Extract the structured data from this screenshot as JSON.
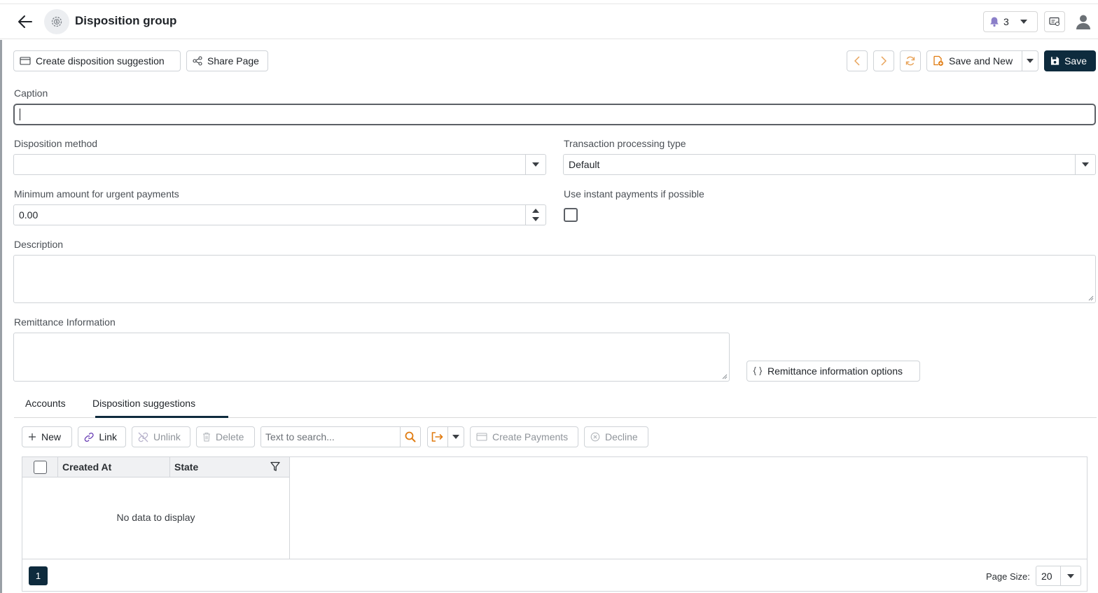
{
  "header": {
    "title": "Disposition group",
    "notification_count": "3",
    "icons": {
      "back": "arrow-left-icon",
      "module": "dollar-gear-icon",
      "notification": "bell-icon",
      "message": "message-icon",
      "user": "user-icon"
    }
  },
  "toolbar": {
    "create_suggestion_label": "Create disposition suggestion",
    "share_label": "Share Page",
    "save_and_new_label": "Save and New",
    "save_label": "Save"
  },
  "form": {
    "caption": {
      "label": "Caption",
      "value": ""
    },
    "disposition_method": {
      "label": "Disposition method",
      "value": ""
    },
    "transaction_processing_type": {
      "label": "Transaction processing type",
      "value": "Default"
    },
    "minimum_amount": {
      "label": "Minimum amount for urgent payments",
      "value": "0.00"
    },
    "use_instant_payments": {
      "label": "Use instant payments if possible",
      "checked": false
    },
    "description": {
      "label": "Description",
      "value": ""
    },
    "remittance_information": {
      "label": "Remittance Information",
      "value": ""
    },
    "remittance_options_label": "Remittance information options"
  },
  "tabs": [
    {
      "label": "Accounts",
      "active": false
    },
    {
      "label": "Disposition suggestions",
      "active": true
    }
  ],
  "grid_toolbar": {
    "new_label": "New",
    "link_label": "Link",
    "unlink_label": "Unlink",
    "delete_label": "Delete",
    "search_placeholder": "Text to search...",
    "create_payments_label": "Create Payments",
    "decline_label": "Decline"
  },
  "grid": {
    "columns": [
      "Created At",
      "State"
    ],
    "empty_text": "No data to display",
    "current_page": "1",
    "page_size_label": "Page Size:",
    "page_size": "20"
  },
  "colors": {
    "primary": "#0e2b3d",
    "accent_orange": "#e07b10",
    "link_purple": "#6a3fb5"
  }
}
